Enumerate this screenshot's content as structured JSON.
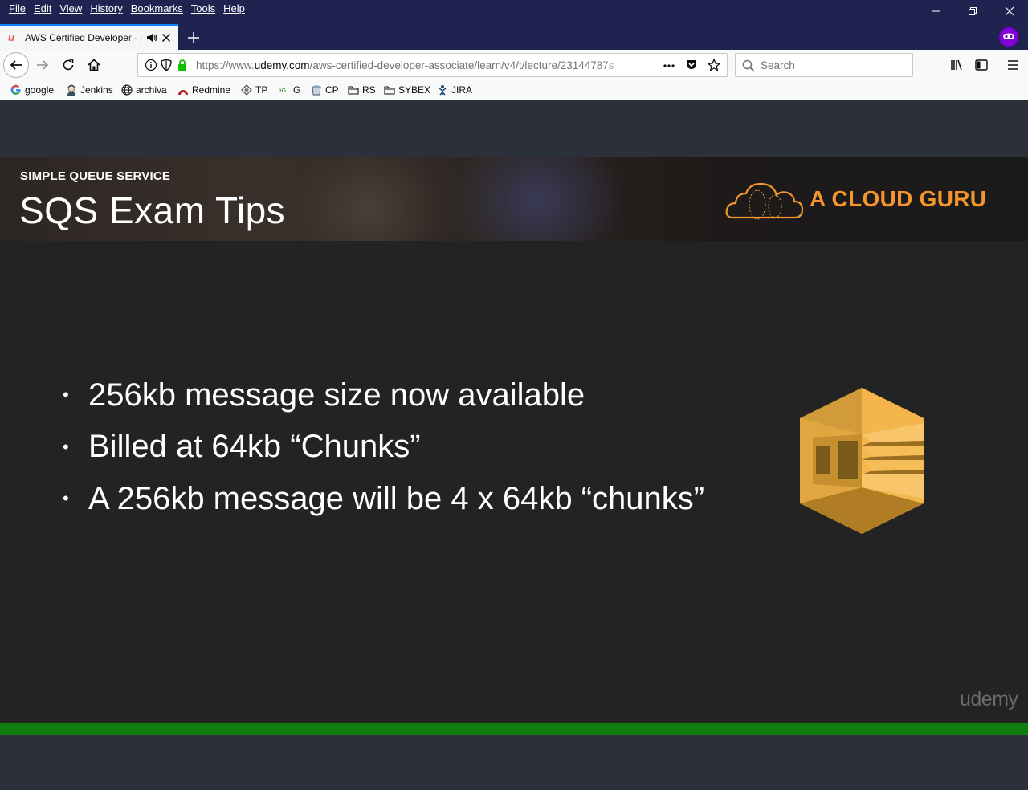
{
  "window": {
    "menu": [
      {
        "label": "File"
      },
      {
        "label": "Edit"
      },
      {
        "label": "View"
      },
      {
        "label": "History"
      },
      {
        "label": "Bookmarks"
      },
      {
        "label": "Tools"
      },
      {
        "label": "Help"
      }
    ]
  },
  "tabs": [
    {
      "title": "AWS Certified Developer - Associate",
      "favicon": "udemy-icon",
      "playing_audio": true
    }
  ],
  "navbar": {
    "url_prefix": "https://www.",
    "url_host": "udemy.com",
    "url_path": "/aws-certified-developer-associate/learn/v4/t/lecture/23144787s",
    "search_placeholder": "Search"
  },
  "bookmarks": [
    {
      "label": "google",
      "icon": "google-icon"
    },
    {
      "label": "Jenkins",
      "icon": "jenkins-icon"
    },
    {
      "label": "archiva",
      "icon": "globe-icon"
    },
    {
      "label": "Redmine",
      "icon": "redmine-icon"
    },
    {
      "label": "TP",
      "icon": "tp-icon"
    },
    {
      "label": "G",
      "icon": "g-icon"
    },
    {
      "label": "CP",
      "icon": "cp-icon"
    },
    {
      "label": "RS",
      "icon": "folder-icon"
    },
    {
      "label": "SYBEX",
      "icon": "folder-icon"
    },
    {
      "label": "JIRA",
      "icon": "jira-icon"
    }
  ],
  "slide": {
    "kicker": "SIMPLE QUEUE SERVICE",
    "title": "SQS Exam Tips",
    "brand": "A CLOUD GURU",
    "bullets": [
      "256kb message size now available",
      "Billed at 64kb “Chunks”",
      "A 256kb message will be 4 x 64kb “chunks”"
    ],
    "watermark": "udemy"
  },
  "colors": {
    "chrome_dark": "#1f2350",
    "accent_orange": "#f4962d",
    "sqs_gold": "#d9a441",
    "progress_green": "#0f7d0f"
  }
}
